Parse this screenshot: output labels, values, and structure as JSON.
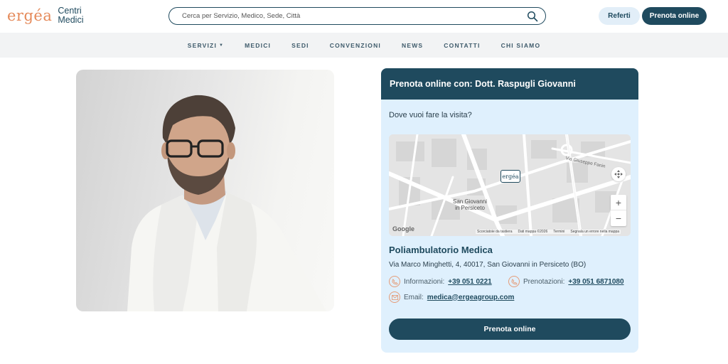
{
  "header": {
    "logo_mark": "ergéa",
    "logo_line1": "Centri",
    "logo_line2": "Medici",
    "search_placeholder": "Cerca per Servizio, Medico, Sede, Città",
    "referti_label": "Referti",
    "prenota_label": "Prenota online"
  },
  "nav": {
    "items": [
      "SERVIZI",
      "MEDICI",
      "SEDI",
      "CONVENZIONI",
      "NEWS",
      "CONTATTI",
      "CHI SIAMO"
    ]
  },
  "booking": {
    "title": "Prenota online con: Dott. Raspugli Giovanni",
    "question": "Dove vuoi fare la visita?",
    "map": {
      "marker_label": "ergéa",
      "town_line1": "San Giovanni",
      "town_line2": "in Persiceto",
      "street_label": "Via Giuseppe Fanin",
      "google_label": "Google",
      "attribution": [
        "Scorciatoie da tastiera",
        "Dati mappa ©2026",
        "Termini",
        "Segnala un errore nella mappa"
      ],
      "zoom_in": "+",
      "zoom_out": "−"
    },
    "place_name": "Poliambulatorio Medica",
    "address": "Via Marco Minghetti, 4, 40017, San Giovanni in Persiceto (BO)",
    "info_label": "Informazioni:",
    "info_phone": "+39 051 0221",
    "pren_label": "Prenotazioni:",
    "pren_phone": "+39 051 6871080",
    "email_label": "Email:",
    "email": "medica@ergeagroup.com",
    "button_label": "Prenota online"
  },
  "colors": {
    "brand_dark": "#1f4a5e",
    "brand_orange": "#e58a5a",
    "panel_bg": "#dff0fd"
  }
}
